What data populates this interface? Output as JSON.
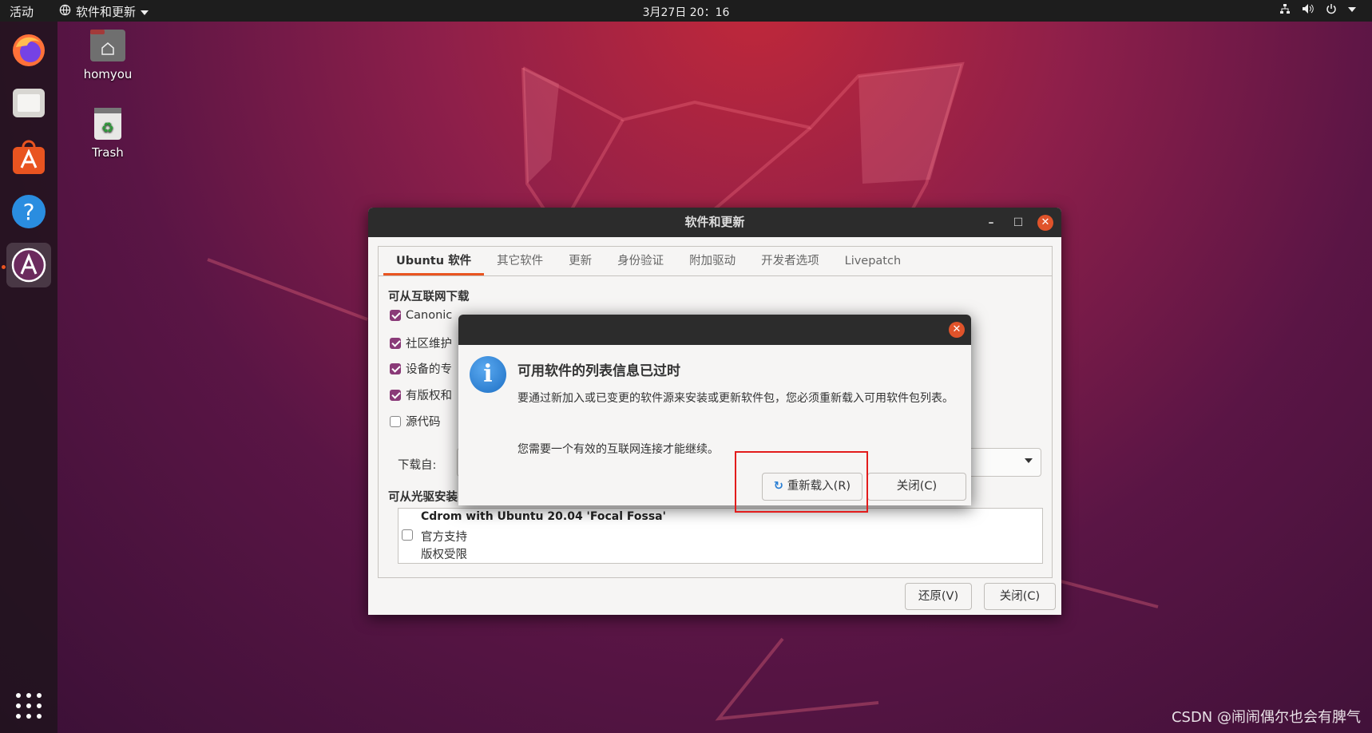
{
  "topbar": {
    "activities": "活动",
    "app_menu": "软件和更新",
    "clock": "3月27日 20：16"
  },
  "desktop": {
    "home_label": "homyou",
    "trash_label": "Trash"
  },
  "window": {
    "title": "软件和更新",
    "tabs": [
      "Ubuntu 软件",
      "其它软件",
      "更新",
      "身份验证",
      "附加驱动",
      "开发者选项",
      "Livepatch"
    ],
    "section_internet": "可从互联网下载",
    "checkboxes": [
      {
        "label": "Canonic",
        "checked": true
      },
      {
        "label": "社区维护",
        "checked": true
      },
      {
        "label": "设备的专",
        "checked": true
      },
      {
        "label": "有版权和",
        "checked": true
      },
      {
        "label": "源代码",
        "checked": false
      }
    ],
    "download_from_label": "下载自:",
    "section_cdrom": "可从光驱安装",
    "cdrom_title": "Cdrom with Ubuntu 20.04 'Focal Fossa'",
    "cdrom_line1": "官方支持",
    "cdrom_line2": "版权受限",
    "revert_button": "还原(V)",
    "close_button": "关闭(C)"
  },
  "dialog": {
    "heading": "可用软件的列表信息已过时",
    "body": "要通过新加入或已变更的软件源来安装或更新软件包，您必须重新载入可用软件包列表。",
    "body2": "您需要一个有效的互联网连接才能继续。",
    "reload_button": "重新载入(R)",
    "close_button": "关闭(C)"
  },
  "watermark": "CSDN @闹闹偶尔也会有脾气",
  "colors": {
    "accent": "#e95420",
    "close_button": "#e0532a",
    "checkbox": "#8a3a78",
    "highlight_box": "#e21c1c"
  }
}
